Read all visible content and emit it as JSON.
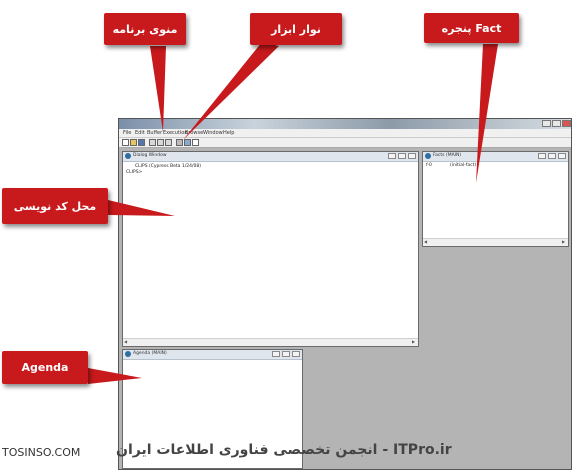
{
  "callouts": {
    "program_menu": "منوی برنامه",
    "toolbar": "نوار ابزار",
    "fact_window": "پنجره Fact",
    "code_area": "محل کد نویسی",
    "agenda": "Agenda"
  },
  "app": {
    "menu": [
      "File",
      "Edit",
      "Buffer",
      "Execution",
      "Browse",
      "Window",
      "Help"
    ]
  },
  "dialog_window": {
    "title": "Dialog Window",
    "lines": [
      "CLIPS (Cypress Beta 1/24/08)",
      "CLIPS>"
    ]
  },
  "facts_window": {
    "title": "Facts (MAIN)",
    "facts": [
      {
        "id": "f-0",
        "value": "(initial-fact)"
      }
    ]
  },
  "agenda_window": {
    "title": "Agenda (MAIN)"
  },
  "footer": {
    "site": "TOSINSO.COM",
    "watermark": "ITPro.ir - انجمن تخصصی فناوری اطلاعات ایران"
  },
  "colors": {
    "callout_red": "#c8191c",
    "workspace_gray": "#b4b4b4"
  }
}
